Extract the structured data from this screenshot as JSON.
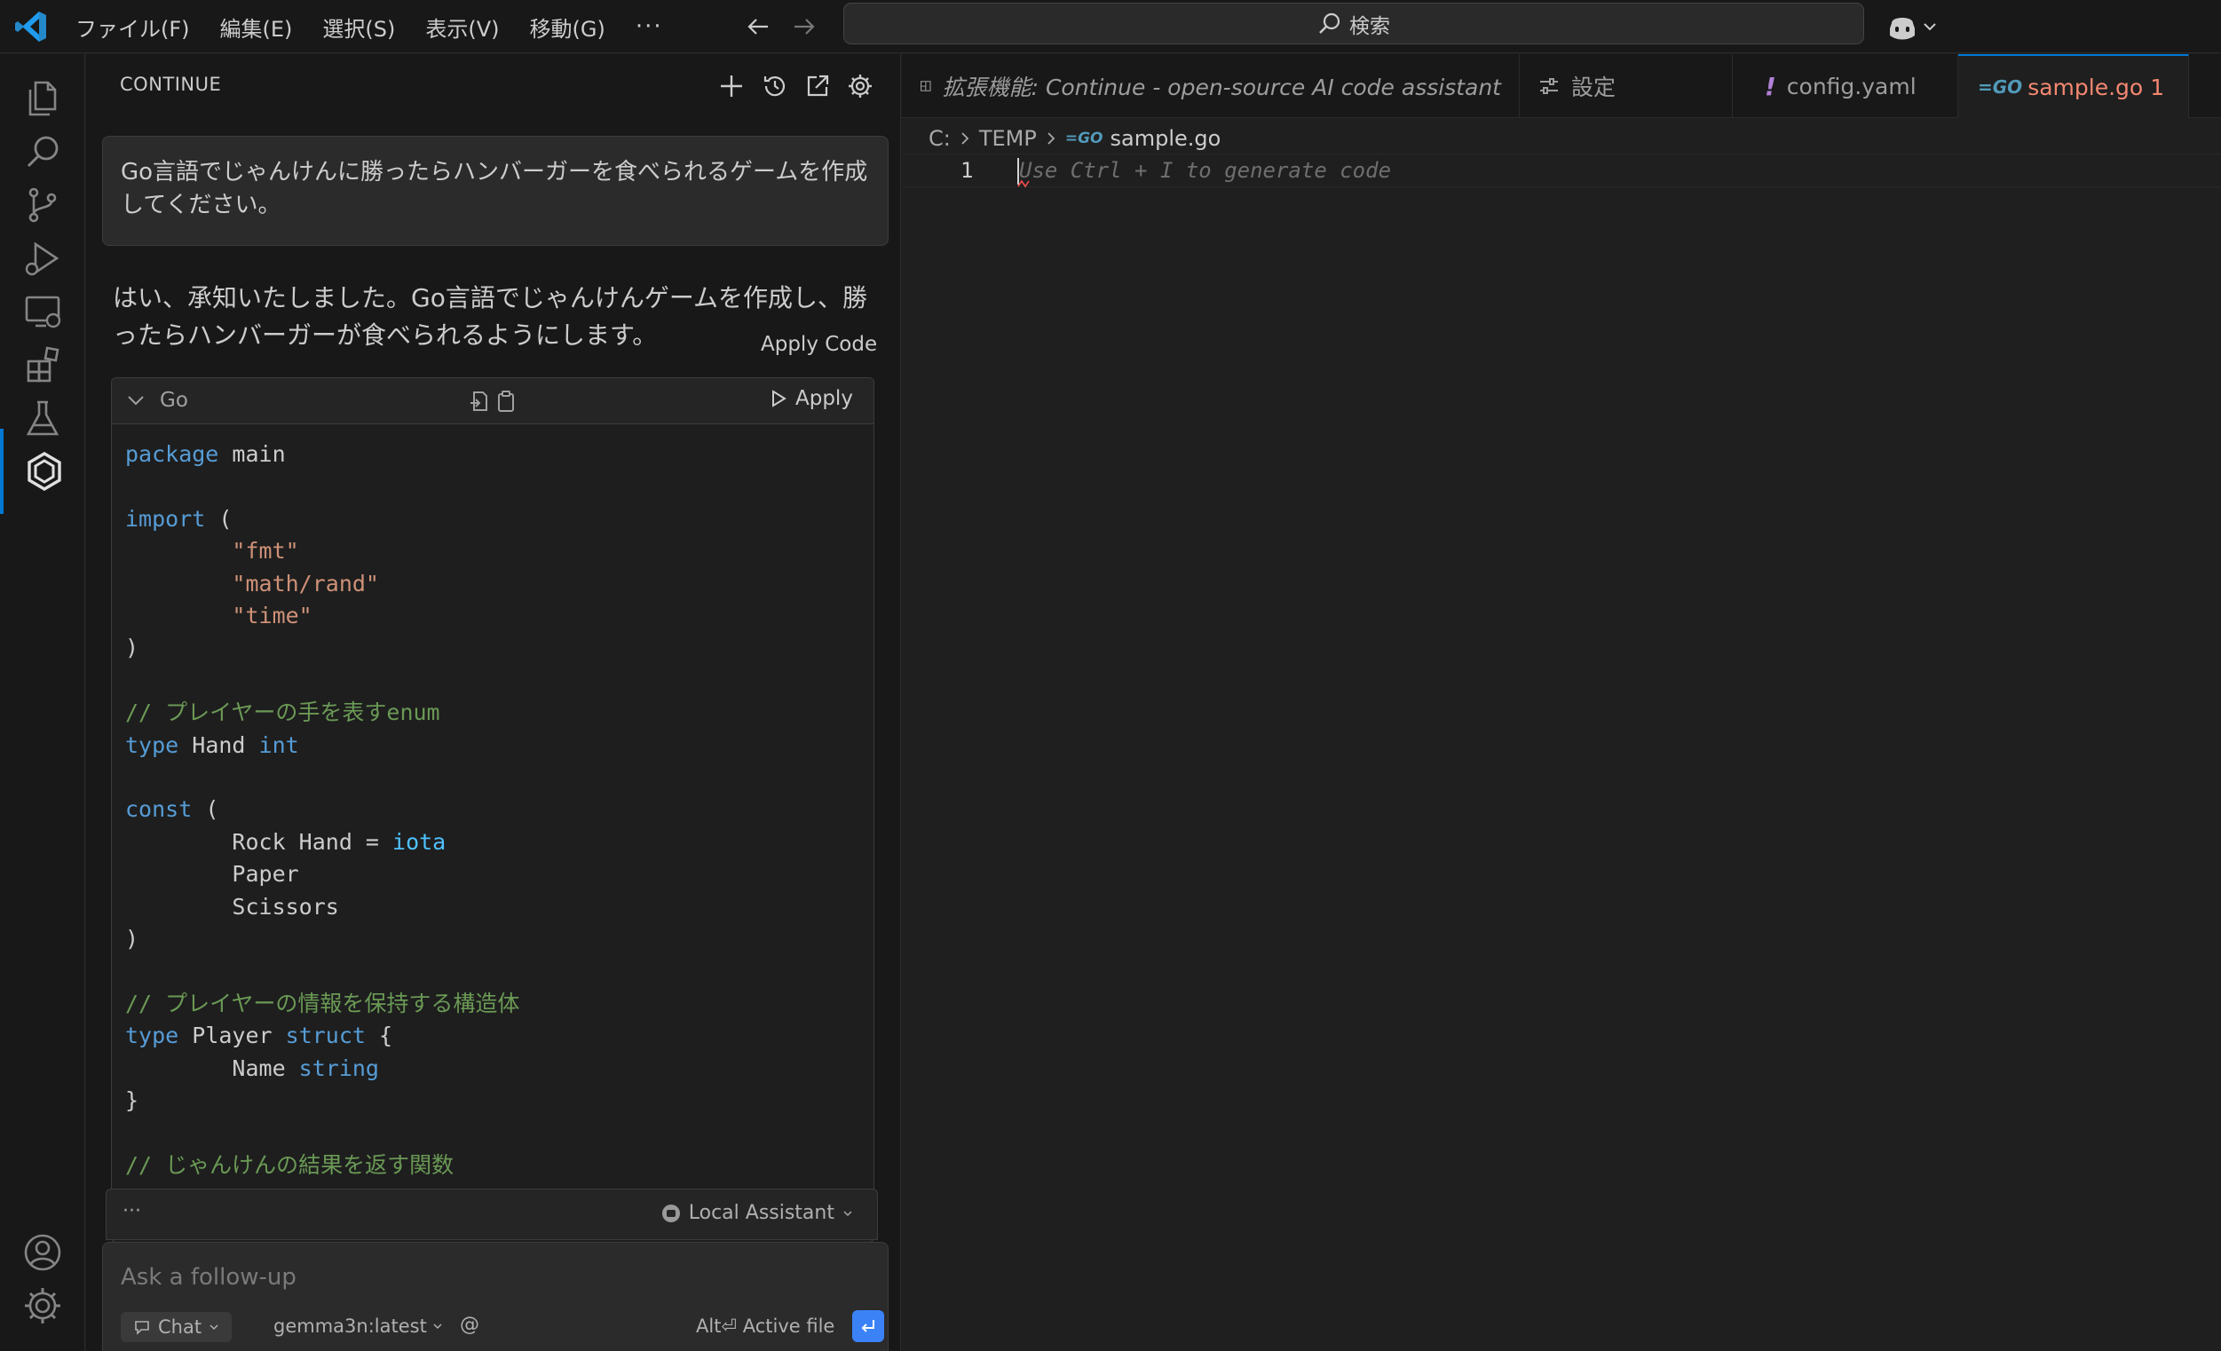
{
  "titlebar": {
    "menu": [
      "ファイル(F)",
      "編集(E)",
      "選択(S)",
      "表示(V)",
      "移動(G)",
      "···"
    ],
    "search_label": "検索"
  },
  "sidebar": {
    "title": "CONTINUE",
    "user_message": "Go言語でじゃんけんに勝ったらハンバーガーを食べられるゲームを作成してください。",
    "assistant_message": "はい、承知いたしました。Go言語でじゃんけんゲームを作成し、勝ったらハンバーガーが食べられるようにします。",
    "apply_code_label": "Apply Code",
    "codeblock": {
      "language": "Go",
      "apply_label": "Apply",
      "lines": [
        "package main",
        "",
        "import (",
        "\t\"fmt\"",
        "\t\"math/rand\"",
        "\t\"time\"",
        ")",
        "",
        "// プレイヤーの手を表すenum",
        "type Hand int",
        "",
        "const (",
        "\tRock Hand = iota",
        "\tPaper",
        "\tScissors",
        ")",
        "",
        "// プレイヤーの情報を保持する構造体",
        "type Player struct {",
        "\tName string",
        "}",
        "",
        "// じゃんけんの結果を返す関数"
      ]
    },
    "footer_dots": "···",
    "assistant_selector": "Local Assistant",
    "input": {
      "placeholder": "Ask a follow-up",
      "mode": "Chat",
      "model": "gemma3n:latest",
      "at": "@",
      "active_file": "Alt⏎ Active file"
    }
  },
  "editor": {
    "tabs": [
      {
        "label": "拡張機能: Continue - open-source AI code assistant",
        "icon": "extension-icon"
      },
      {
        "label": "設定",
        "icon": "settings-sliders-icon"
      },
      {
        "label": "config.yaml",
        "icon": "warning-exclamation-icon"
      },
      {
        "label": "sample.go",
        "badge": "1",
        "icon": "go-file-icon"
      }
    ],
    "breadcrumb": [
      "C:",
      "TEMP",
      "sample.go"
    ],
    "line_number": "1",
    "ghost_text": "Use Ctrl + I to generate code"
  },
  "colors": {
    "accent": "#0078d4",
    "active_tab_text": "#f48771",
    "go_icon": "#519aba",
    "keyword": "#569cd6",
    "string": "#ce9178",
    "comment": "#6a9955",
    "type": "#4ec9b0"
  }
}
